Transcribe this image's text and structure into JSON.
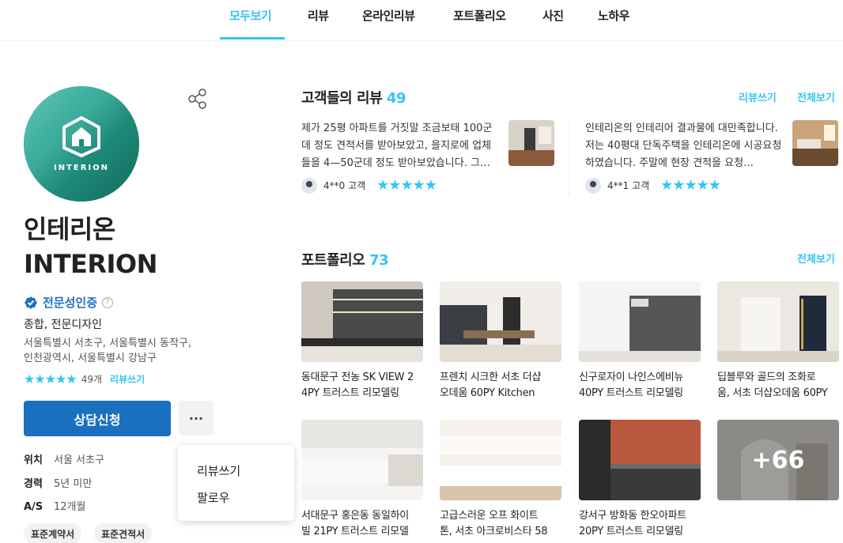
{
  "nav": {
    "tabs": [
      "모두보기",
      "리뷰",
      "온라인리뷰",
      "포트폴리오",
      "사진",
      "노하우"
    ],
    "active_index": 0
  },
  "profile": {
    "logo_text": "INTERION",
    "name_line1": "인테리온",
    "name_line2": "INTERION",
    "verified_label": "전문성인증",
    "help_glyph": "?",
    "category": "종합, 전문디자인",
    "address_line1": "서울특별시 서초구, 서울특별시 동작구,",
    "address_line2": "인천광역시, 서울특별시 강남구",
    "stars": "★★★★★",
    "review_count": "49개",
    "write_review": "리뷰쓰기",
    "rating": 5,
    "consult_button": "상담신청",
    "more_button": "···",
    "location_key": "위치",
    "location_value": "서울 서초구",
    "career_key": "경력",
    "career_value": "5년 미만",
    "as_key": "A/S",
    "as_value": "12개월",
    "badges": [
      "표준계약서",
      "표준견적서"
    ]
  },
  "dropdown": {
    "items": [
      "리뷰쓰기",
      "팔로우"
    ]
  },
  "reviews_section": {
    "title": "고객들의 리뷰",
    "count": "49",
    "write_link": "리뷰쓰기",
    "all_link": "전체보기",
    "items": [
      {
        "text": "제가 25평 아파트를 거짓말 조금보태 100군데 정도 견적서를 받아보았고, 을지로에 업체들을 4—50군데 정도 받아보았습니다. 그…",
        "author": "4**0 고객",
        "stars": "★★★★★",
        "rating": 5
      },
      {
        "text": "인테리온의 인테리어 결과물에 대만족합니다. 저는 40평대 단독주택을 인테리온에 시공요청하였습니다. 주말에 현장 견적을 요청…",
        "author": "4**1 고객",
        "stars": "★★★★★",
        "rating": 5
      }
    ]
  },
  "portfolio_section": {
    "title": "포트폴리오",
    "count": "73",
    "all_link": "전체보기",
    "items": [
      {
        "cap1": "동대문구 전농 SK VIEW 2",
        "cap2": "4PY 트러스트 리모델링"
      },
      {
        "cap1": "프렌치 시크한 서초 더샵",
        "cap2": "오데움 60PY Kitchen"
      },
      {
        "cap1": "신구로자이 나인스에비뉴",
        "cap2": "40PY 트러스트 리모델링"
      },
      {
        "cap1": "딥블루와 골드의 조화로",
        "cap2": "움, 서초 더샵오데움 60PY"
      },
      {
        "cap1": "서대문구 홍은동 동일하이",
        "cap2": "빌 21PY 트러스트 리모델"
      },
      {
        "cap1": "고급스러운 오프 화이트",
        "cap2": "톤, 서초 아크로비스타 58"
      },
      {
        "cap1": "강서구 방화동 한오아파트",
        "cap2": "20PY 트러스트 리모델링"
      }
    ],
    "more_overlay": "+66"
  }
}
